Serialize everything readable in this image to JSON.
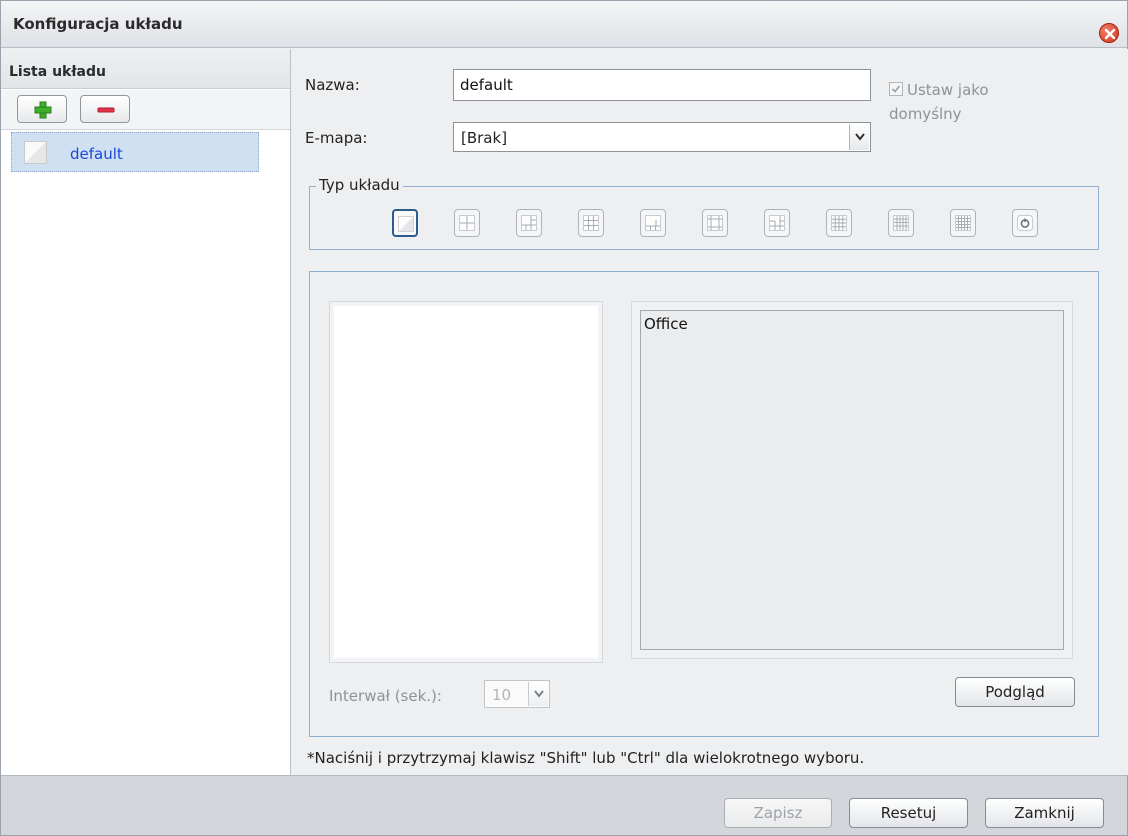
{
  "window": {
    "title": "Konfiguracja układu"
  },
  "sidebar": {
    "header": "Lista układu",
    "items": [
      {
        "label": "default",
        "selected": true
      }
    ]
  },
  "form": {
    "name_label": "Nazwa:",
    "name_value": "default",
    "emap_label": "E-mapa:",
    "emap_value": "[Brak]",
    "default_checkbox": {
      "label_line1": "Ustaw jako",
      "label_line2": "domyślny",
      "checked": true,
      "disabled": true
    }
  },
  "layout_type": {
    "legend": "Typ układu",
    "options": [
      {
        "icon": "layout-1x1-icon",
        "selected": true
      },
      {
        "icon": "layout-2x2-icon"
      },
      {
        "icon": "layout-1plus3-icon"
      },
      {
        "icon": "layout-3x3-icon"
      },
      {
        "icon": "layout-1plus5-icon"
      },
      {
        "icon": "layout-1plus7-icon"
      },
      {
        "icon": "layout-1plus8-icon"
      },
      {
        "icon": "layout-4x4-icon"
      },
      {
        "icon": "layout-4x5-icon"
      },
      {
        "icon": "layout-5x5-icon"
      },
      {
        "icon": "layout-sequential-icon"
      }
    ]
  },
  "preview": {
    "camera_list": [
      "Office"
    ],
    "interval_label": "Interwał (sek.):",
    "interval_value": "10",
    "preview_button": "Podgląd"
  },
  "note": "*Naciśnij i przytrzymaj klawisz \"Shift\" lub \"Ctrl\" dla wielokrotnego wyboru.",
  "footer": {
    "save": "Zapisz",
    "reset": "Resetuj",
    "close": "Zamknij"
  },
  "colors": {
    "accent_blue": "#2c5b8e",
    "selected_row": "#cfe0f2",
    "link_text": "#1e47d8",
    "close_red": "#cf3417"
  }
}
